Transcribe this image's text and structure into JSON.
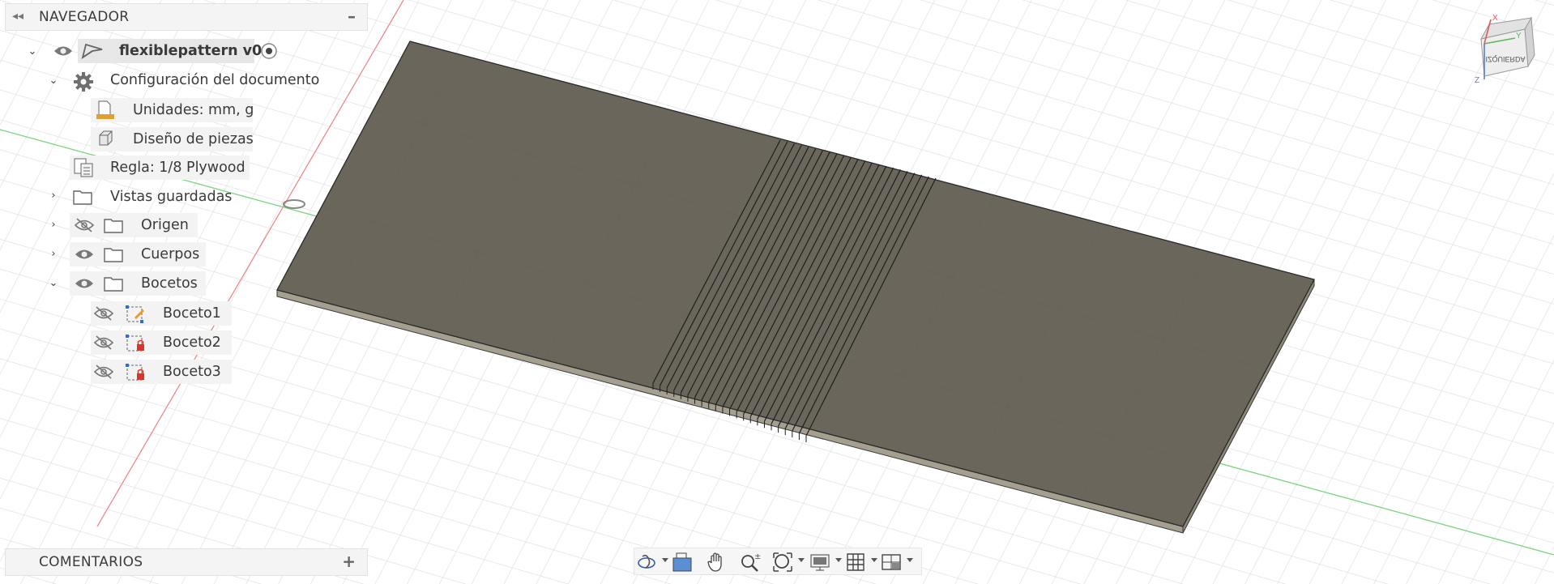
{
  "browser": {
    "title": "NAVEGADOR",
    "root": {
      "name": "flexiblepattern v0"
    },
    "items": {
      "settings": "Configuración del documento",
      "units": "Unidades: mm, g",
      "design": "Diseño de piezas",
      "rule": "Regla: 1/8 Plywood",
      "views": "Vistas guardadas",
      "origin": "Origen",
      "bodies": "Cuerpos",
      "sketches": "Bocetos",
      "sketch1": "Boceto1",
      "sketch2": "Boceto2",
      "sketch3": "Boceto3"
    }
  },
  "comments": {
    "title": "COMENTARIOS"
  },
  "viewcube": {
    "face_label": "IZQUIERDA",
    "axes": {
      "x": "X",
      "y": "Y",
      "z": "Z"
    }
  },
  "colors": {
    "top_face": "#6a665c",
    "side_face": "#a59f8f",
    "grid": "#dcdcdc",
    "green_axis": "#6ad16a",
    "red_axis": "#e86a6a",
    "panel_bg": "#f4f4f4"
  },
  "toolbar": [
    "orbit-icon",
    "look-at-icon",
    "pan-icon",
    "zoom-icon",
    "fit-icon",
    "display-settings-icon",
    "grid-icon",
    "viewports-icon"
  ]
}
